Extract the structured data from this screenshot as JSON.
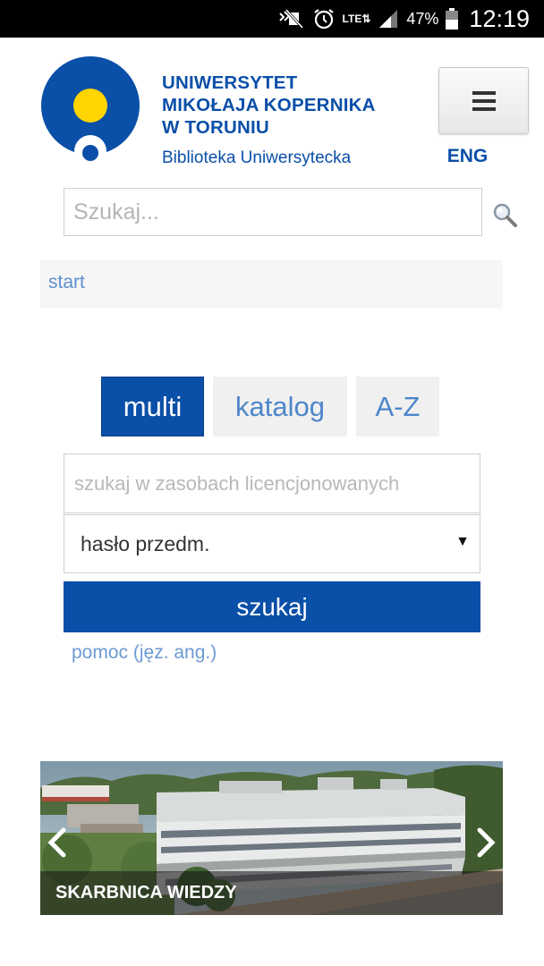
{
  "status_bar": {
    "network": "LTE",
    "battery_percent": "47%",
    "time": "12:19",
    "icons": [
      "nfc-mute-icon",
      "alarm-icon",
      "lte-icon",
      "signal-icon",
      "battery-icon"
    ]
  },
  "header": {
    "uni_name_lines": [
      "UNIWERSYTET",
      "MIKOŁAJA KOPERNIKA",
      "W TORUNIU"
    ],
    "library_name": "Biblioteka Uniwersytecka",
    "language_link": "ENG",
    "menu_icon": "hamburger-icon"
  },
  "site_search": {
    "placeholder": "Szukaj...",
    "icon": "magnifier-icon"
  },
  "breadcrumb": {
    "current": "start"
  },
  "search_tabs": {
    "items": [
      "multi",
      "katalog",
      "A-Z"
    ],
    "active": "multi"
  },
  "multi_search": {
    "placeholder": "szukaj w zasobach licencjonowanych",
    "field_select": "hasło przedm.",
    "submit_label": "szukaj",
    "help_link": "pomoc (jęz. ang.)"
  },
  "slider": {
    "caption": "SKARBNICA WIEDZY"
  },
  "colors": {
    "brand_blue": "#0a4fa8",
    "logo_yellow": "#ffd400",
    "link_blue": "#5c8fcf"
  }
}
